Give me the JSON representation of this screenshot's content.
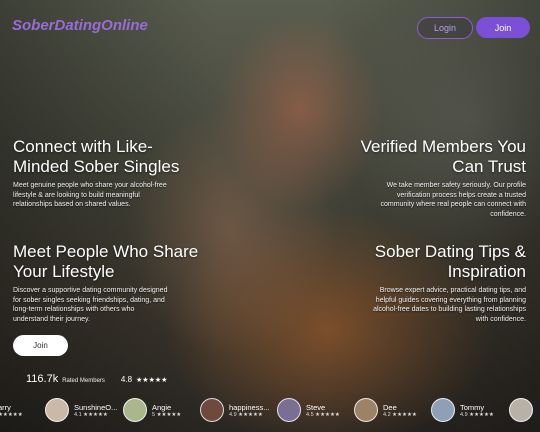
{
  "header": {
    "logo": "SoberDatingOnline",
    "login_label": "Login",
    "join_label": "Join"
  },
  "features": [
    {
      "title_line1": "Connect with Like-",
      "title_line2": "Minded Sober Singles",
      "text_line1": "Meet genuine people who share your alcohol-free",
      "text_line2": "lifestyle & are looking to build meaningful",
      "text_line3": "relationships based on shared values."
    },
    {
      "title_line1": "Verified Members You",
      "title_line2": "Can Trust",
      "text_line1": "We take member safety seriously. Our profile",
      "text_line2": "verification process helps create a trusted",
      "text_line3": "community where real people can connect with",
      "text_line4": "confidence."
    },
    {
      "title_line1": "Meet People Who Share",
      "title_line2": "Your Lifestyle",
      "text_line1": "Discover a supportive dating community designed",
      "text_line2": "for sober singles seeking friendships, dating, and",
      "text_line3": "long-term relationships with others who",
      "text_line4": "understand their journey."
    },
    {
      "title_line1": "Sober Dating Tips &",
      "title_line2": "Inspiration",
      "text_line1": "Browse expert advice, practical dating tips, and",
      "text_line2": "helpful guides covering everything from planning",
      "text_line3": "alcohol-free dates to building lasting relationships",
      "text_line4": "with confidence."
    }
  ],
  "cta": {
    "join_label": "Join"
  },
  "stats": {
    "members_count": "116.7k",
    "members_label": "Rated Members",
    "rating": "4.8",
    "rating_stars": "★★★★★"
  },
  "members": [
    {
      "name": "arry",
      "rating": "★★★★★",
      "color": "#8a6a55"
    },
    {
      "name": "SunshineO...",
      "rating": "4.1 ★★★★★",
      "color": "#c9b9a6"
    },
    {
      "name": "Angie",
      "rating": "5 ★★★★★",
      "color": "#a8b88c"
    },
    {
      "name": "happiness...",
      "rating": "4.9 ★★★★★",
      "color": "#6e4a3e"
    },
    {
      "name": "Steve",
      "rating": "4.5 ★★★★★",
      "color": "#7a6e92"
    },
    {
      "name": "Dee",
      "rating": "4.2 ★★★★★",
      "color": "#9e8266"
    },
    {
      "name": "Tommy",
      "rating": "4.9 ★★★★★",
      "color": "#8f9fb6"
    },
    {
      "name": "",
      "rating": "",
      "color": "#b7b1a8"
    }
  ]
}
